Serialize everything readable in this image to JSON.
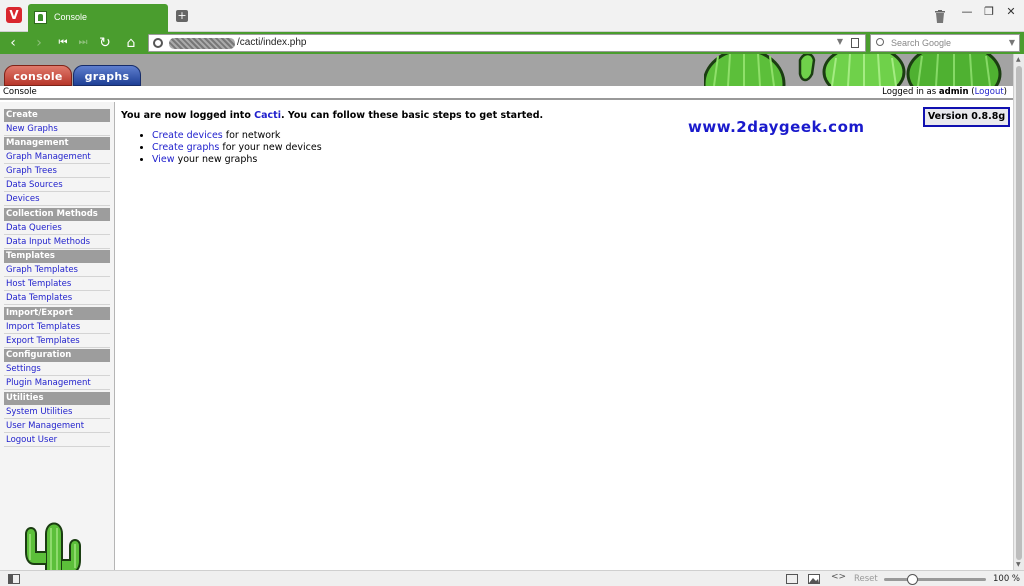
{
  "browser": {
    "tab_title": "Console",
    "url": "/cacti/index.php",
    "search_placeholder": "Search Google",
    "zoom_reset_label": "Reset",
    "zoom_level": "100 %",
    "zoom_level_value": 100
  },
  "colors": {
    "brand_green": "#4a9d2e",
    "link_blue": "#1e1ecc",
    "menu_header_gray": "#9d9d9d",
    "console_tab_red": "#b7362a",
    "graphs_tab_blue": "#1e3f95"
  },
  "cacti": {
    "tabs": {
      "console": "console",
      "graphs": "graphs"
    },
    "breadcrumb": "Console",
    "login_prefix": "Logged in as ",
    "login_user": "admin",
    "logout_label": "Logout",
    "version": "Version 0.8.8g",
    "watermark": "www.2daygeek.com",
    "welcome_prefix": "You are now logged into ",
    "welcome_app": "Cacti",
    "welcome_suffix": ". You can follow these basic steps to get started.",
    "steps": [
      {
        "link": "Create devices",
        "text": " for network"
      },
      {
        "link": "Create graphs",
        "text": " for your new devices"
      },
      {
        "link": "View",
        "text": " your new graphs"
      }
    ],
    "menu": {
      "h_create": "Create",
      "new_graphs": "New Graphs",
      "h_management": "Management",
      "graph_management": "Graph Management",
      "graph_trees": "Graph Trees",
      "data_sources": "Data Sources",
      "devices": "Devices",
      "h_collection": "Collection Methods",
      "data_queries": "Data Queries",
      "data_input_methods": "Data Input Methods",
      "h_templates": "Templates",
      "graph_templates": "Graph Templates",
      "host_templates": "Host Templates",
      "data_templates": "Data Templates",
      "h_import_export": "Import/Export",
      "import_templates": "Import Templates",
      "export_templates": "Export Templates",
      "h_configuration": "Configuration",
      "settings": "Settings",
      "plugin_management": "Plugin Management",
      "h_utilities": "Utilities",
      "system_utilities": "System Utilities",
      "user_management": "User Management",
      "logout_user": "Logout User"
    }
  }
}
